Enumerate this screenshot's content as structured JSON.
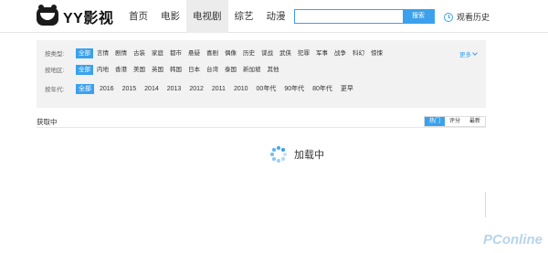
{
  "header": {
    "logo_text": "YY影视",
    "nav": [
      {
        "label": "首页",
        "active": false
      },
      {
        "label": "电影",
        "active": false
      },
      {
        "label": "电视剧",
        "active": true
      },
      {
        "label": "综艺",
        "active": false
      },
      {
        "label": "动漫",
        "active": false
      }
    ],
    "search": {
      "value": "",
      "placeholder": "",
      "button_label": "搜索"
    },
    "history_label": "观看历史"
  },
  "filters": {
    "type": {
      "label": "按类型:",
      "options": [
        "全部",
        "言情",
        "剧情",
        "古装",
        "家庭",
        "都市",
        "悬疑",
        "喜剧",
        "偶像",
        "历史",
        "谍战",
        "武侠",
        "犯罪",
        "军事",
        "战争",
        "科幻",
        "惊悚"
      ],
      "active_index": 0
    },
    "region": {
      "label": "按地区:",
      "options": [
        "全部",
        "内地",
        "香港",
        "美国",
        "英国",
        "韩国",
        "日本",
        "台湾",
        "泰国",
        "新加坡",
        "其他"
      ],
      "active_index": 0
    },
    "year": {
      "label": "按年代:",
      "options": [
        "全部",
        "2016",
        "2015",
        "2014",
        "2013",
        "2012",
        "2011",
        "2010",
        "00年代",
        "90年代",
        "80年代",
        "更早"
      ],
      "active_index": 0
    },
    "more_label": "更多"
  },
  "list_status": {
    "text": "获取中",
    "sort_options": [
      "热门",
      "评分",
      "最新"
    ],
    "active_sort": 0
  },
  "loading_text": "加载中",
  "watermark_text": "PConline",
  "colors": {
    "accent": "#3ba1ec",
    "filter_bg": "#f2f2f2"
  }
}
